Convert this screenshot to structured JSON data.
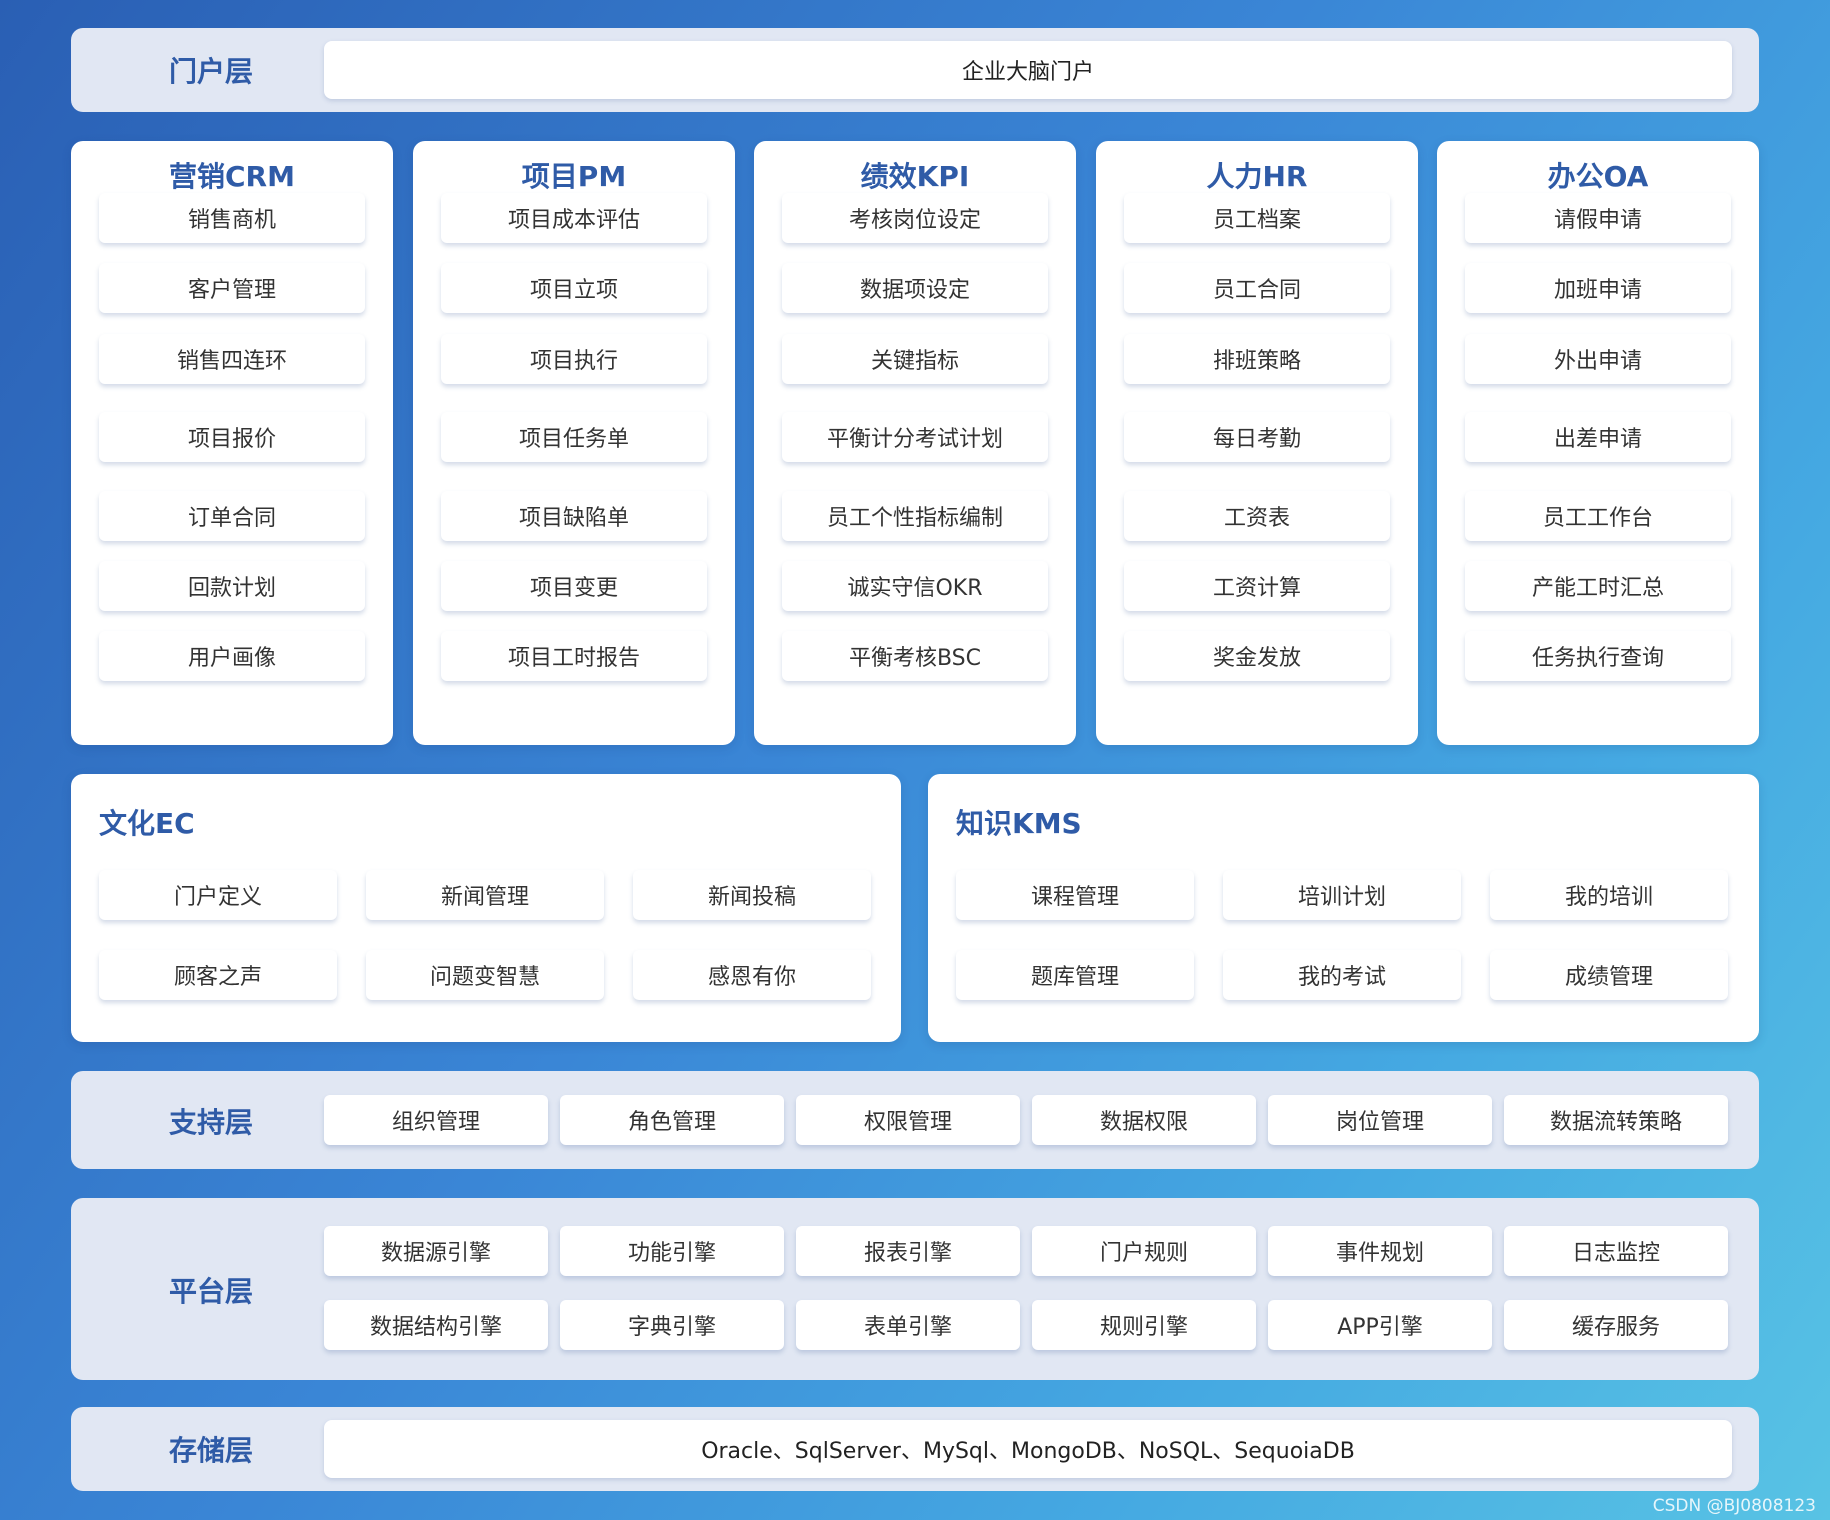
{
  "portal": {
    "label": "门户层",
    "content": "企业大脑门户"
  },
  "modules": [
    {
      "title": "营销CRM",
      "items": [
        "销售商机",
        "客户管理",
        "销售四连环",
        "项目报价",
        "订单合同",
        "回款计划",
        "用户画像"
      ]
    },
    {
      "title": "项目PM",
      "items": [
        "项目成本评估",
        "项目立项",
        "项目执行",
        "项目任务单",
        "项目缺陷单",
        "项目变更",
        "项目工时报告"
      ]
    },
    {
      "title": "绩效KPI",
      "items": [
        "考核岗位设定",
        "数据项设定",
        "关键指标",
        "平衡计分考试计划",
        "员工个性指标编制",
        "诚实守信OKR",
        "平衡考核BSC"
      ]
    },
    {
      "title": "人力HR",
      "items": [
        "员工档案",
        "员工合同",
        "排班策略",
        "每日考勤",
        "工资表",
        "工资计算",
        "奖金发放"
      ]
    },
    {
      "title": "办公OA",
      "items": [
        "请假申请",
        "加班申请",
        "外出申请",
        "出差申请",
        "员工工作台",
        "产能工时汇总",
        "任务执行查询"
      ]
    }
  ],
  "culture": {
    "title": "文化EC",
    "items": [
      "门户定义",
      "新闻管理",
      "新闻投稿",
      "顾客之声",
      "问题变智慧",
      "感恩有你"
    ]
  },
  "knowledge": {
    "title": "知识KMS",
    "items": [
      "课程管理",
      "培训计划",
      "我的培训",
      "题库管理",
      "我的考试",
      "成绩管理"
    ]
  },
  "support": {
    "label": "支持层",
    "items": [
      "组织管理",
      "角色管理",
      "权限管理",
      "数据权限",
      "岗位管理",
      "数据流转策略"
    ]
  },
  "platform": {
    "label": "平台层",
    "items": [
      "数据源引擎",
      "功能引擎",
      "报表引擎",
      "门户规则",
      "事件规划",
      "日志监控",
      "数据结构引擎",
      "字典引擎",
      "表单引擎",
      "规则引擎",
      "APP引擎",
      "缓存服务"
    ]
  },
  "storage": {
    "label": "存储层",
    "content": "Oracle、SqlServer、MySql、MongoDB、NoSQL、SequoiaDB"
  },
  "watermark": "CSDN @BJ0808123"
}
